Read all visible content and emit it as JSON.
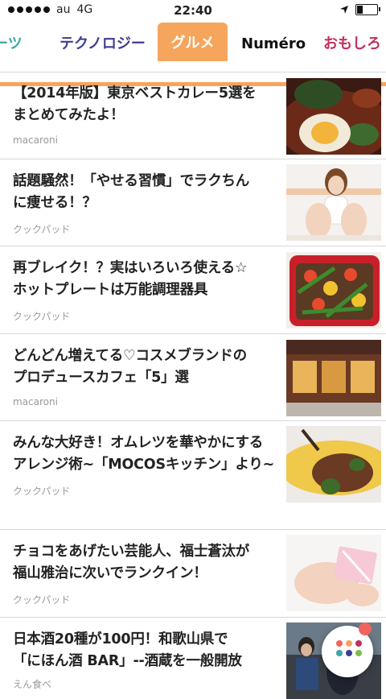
{
  "status_bar": {
    "carrier": "au",
    "network": "4G",
    "time": "22:40"
  },
  "tabs": [
    {
      "label": "ーツ"
    },
    {
      "label": "テクノロジー"
    },
    {
      "label": "グルメ"
    },
    {
      "label": "Numéro"
    },
    {
      "label": "おもしろ"
    }
  ],
  "articles": [
    {
      "title_lines": [
        "【2014年版】東京ベストカレー5選を",
        "まとめてみたよ！"
      ],
      "source": "macaroni",
      "image": "curry-photo"
    },
    {
      "title_lines": [
        "話題騒然！「やせる習慣」でラクちん",
        "に痩せる！？"
      ],
      "source": "クックパッド",
      "image": "woman-photo"
    },
    {
      "title_lines": [
        "再ブレイク！？実はいろいろ使える☆",
        "ホットプレートは万能調理器具"
      ],
      "source": "クックパッド",
      "image": "hotplate-photo"
    },
    {
      "title_lines": [
        "どんどん増えてる♡コスメブランドの",
        "プロデュースカフェ「5」選"
      ],
      "source": "macaroni",
      "image": "cafe-photo"
    },
    {
      "title_lines": [
        "みんな大好き！オムレツを華やかにする",
        "アレンジ術~「MOCOSキッチン」より~"
      ],
      "source": "クックパッド",
      "image": "omelette-photo"
    },
    {
      "title_lines": [
        "チョコをあげたい芸能人、福士蒼汰が",
        "福山雅治に次いでランクイン！"
      ],
      "source": "クックパッド",
      "image": "gift-photo"
    },
    {
      "title_lines": [
        "日本酒20種が100円！和歌山県で",
        "「にほん酒 BAR」--酒蔵を一般開放"
      ],
      "source": "えん食べ",
      "image": "sake-photo"
    }
  ],
  "colors": {
    "accent": "#f6a55d",
    "sports": "#3aa7a5",
    "tech": "#3f3d8f",
    "fun": "#c0305a"
  }
}
